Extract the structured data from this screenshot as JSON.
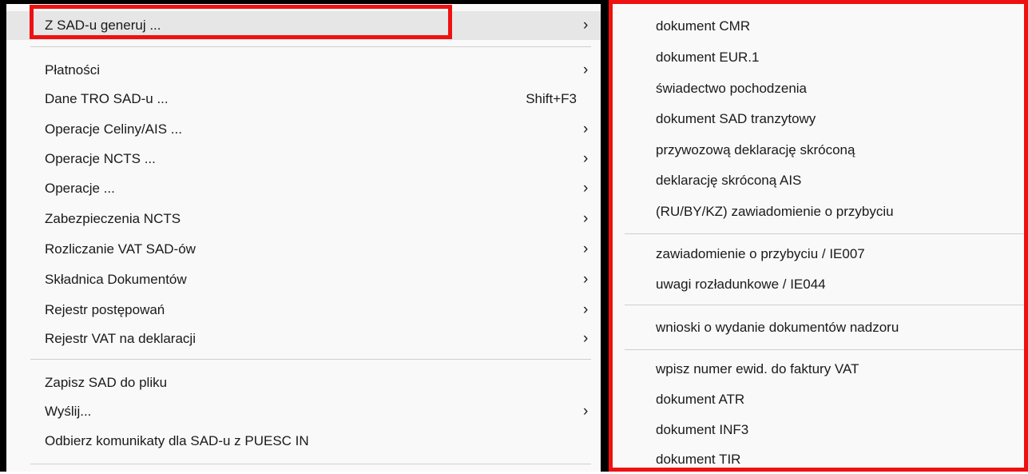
{
  "context_menu": {
    "items": [
      {
        "label": "Z SAD-u generuj ...",
        "arrow": "›"
      },
      {
        "label": "Płatności",
        "arrow": "›"
      },
      {
        "label": "Dane TRO SAD-u ...",
        "shortcut": "Shift+F3"
      },
      {
        "label": "Operacje Celiny/AIS ...",
        "arrow": "›"
      },
      {
        "label": "Operacje NCTS ...",
        "arrow": "›"
      },
      {
        "label": "Operacje ...",
        "arrow": "›"
      },
      {
        "label": "Zabezpieczenia NCTS",
        "arrow": "›"
      },
      {
        "label": "Rozliczanie VAT SAD-ów",
        "arrow": "›"
      },
      {
        "label": "Składnica Dokumentów",
        "arrow": "›"
      },
      {
        "label": "Rejestr postępowań",
        "arrow": "›"
      },
      {
        "label": "Rejestr VAT na deklaracji",
        "arrow": "›"
      },
      {
        "label": "Zapisz SAD do pliku"
      },
      {
        "label": "Wyślij...",
        "arrow": "›"
      },
      {
        "label": "Odbierz komunikaty dla SAD-u z PUESC IN"
      }
    ]
  },
  "submenu": {
    "items": [
      {
        "label": "dokument CMR"
      },
      {
        "label": "dokument EUR.1"
      },
      {
        "label": "świadectwo pochodzenia"
      },
      {
        "label": "dokument SAD tranzytowy"
      },
      {
        "label": "przywozową deklarację skróconą"
      },
      {
        "label": "deklarację skróconą AIS"
      },
      {
        "label": "(RU/BY/KZ) zawiadomienie o przybyciu"
      },
      {
        "label": "zawiadomienie o przybyciu / IE007"
      },
      {
        "label": "uwagi rozładunkowe / IE044"
      },
      {
        "label": "wnioski o wydanie dokumentów nadzoru"
      },
      {
        "label": "wpisz numer ewid. do faktury VAT"
      },
      {
        "label": "dokument ATR"
      },
      {
        "label": "dokument INF3"
      },
      {
        "label": "dokument TIR"
      }
    ]
  },
  "colors": {
    "highlight": "#ee1111",
    "menu_bg": "#f9f9f9",
    "hover_bg": "#e6e6e6"
  }
}
